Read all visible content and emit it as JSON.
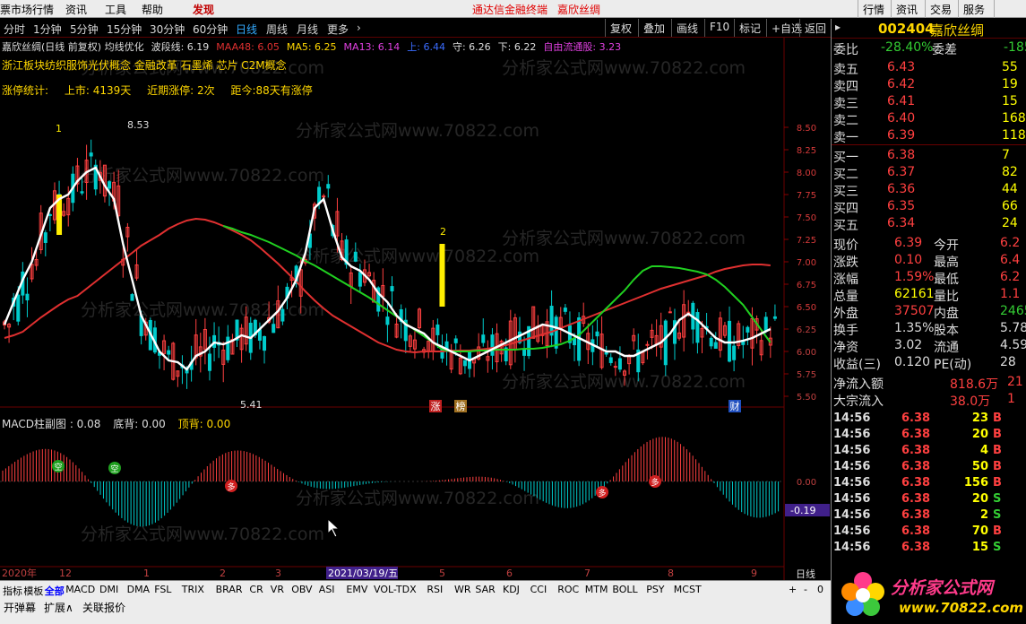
{
  "menu": {
    "items": [
      "票市场行情",
      "资讯",
      "工具",
      "帮助"
    ],
    "discover": "发现",
    "brand": "通达信金融终端",
    "stock_title": "嘉欣丝绸",
    "right": [
      "行情",
      "资讯",
      "交易",
      "服务"
    ]
  },
  "periods": [
    "分时",
    "1分钟",
    "5分钟",
    "15分钟",
    "30分钟",
    "60分钟",
    "日线",
    "周线",
    "月线",
    "更多"
  ],
  "active_period": "日线",
  "toolbar": [
    "复权",
    "叠加",
    "画线",
    "F10",
    "标记",
    "+自选",
    "返回"
  ],
  "info": {
    "line1": [
      {
        "t": "嘉欣丝绸(日线 前复权) 均线优化",
        "c": "#ddd"
      },
      {
        "t": "波段线: 6.19",
        "c": "#ddd"
      },
      {
        "t": "MAA48: 6.05",
        "c": "#e03030"
      },
      {
        "t": "MA5: 6.25",
        "c": "#ffd700"
      },
      {
        "t": "MA13: 6.14",
        "c": "#e040e0"
      },
      {
        "t": "上: 6.44",
        "c": "#3a6cff"
      },
      {
        "t": "守: 6.26",
        "c": "#ddd"
      },
      {
        "t": "下: 6.22",
        "c": "#ddd"
      },
      {
        "t": "自由流通股: 3.23",
        "c": "#e040e0"
      }
    ],
    "concepts": "浙江板块纺织服饰光伏概念 金融改革 石墨烯 芯片 C2M概念",
    "limit": {
      "label": "涨停统计:",
      "listed": "上市: 4139天",
      "recent": "近期涨停: 2次",
      "since": "距今:88天有涨停"
    }
  },
  "chart_data": {
    "type": "line",
    "title": "嘉欣丝绸(日线 前复权)",
    "ylim": [
      5.5,
      8.8
    ],
    "y_ticks": [
      "8.50",
      "8.25",
      "8.00",
      "7.75",
      "7.50",
      "7.25",
      "7.00",
      "6.75",
      "6.50",
      "6.25",
      "6.00",
      "5.75",
      "5.50"
    ],
    "series": [
      {
        "name": "MAA48",
        "color": "#e03030",
        "values": [
          6.15,
          6.18,
          6.22,
          6.3,
          6.38,
          6.45,
          6.52,
          6.58,
          6.62,
          6.7,
          6.78,
          6.86,
          6.94,
          7.02,
          7.1,
          7.18,
          7.24,
          7.3,
          7.37,
          7.42,
          7.46,
          7.48,
          7.47,
          7.44,
          7.4,
          7.35,
          7.3,
          7.24,
          7.16,
          7.07,
          6.98,
          6.88,
          6.78,
          6.67,
          6.57,
          6.48,
          6.4,
          6.34,
          6.28,
          6.22,
          6.16,
          6.1,
          6.06,
          6.02,
          6.0,
          5.99,
          6.0,
          6.0,
          6.0,
          6.01,
          6.01,
          6.01,
          6.02,
          6.03,
          6.05,
          6.07,
          6.1,
          6.13,
          6.16,
          6.19,
          6.22,
          6.26,
          6.3,
          6.34,
          6.38,
          6.42,
          6.46,
          6.5,
          6.54,
          6.58,
          6.62,
          6.66,
          6.7,
          6.73,
          6.76,
          6.79,
          6.82,
          6.85,
          6.89,
          6.92,
          6.94,
          6.96,
          6.97,
          6.97,
          6.96
        ]
      },
      {
        "name": "MA48",
        "color": "#20d020",
        "values": [
          null,
          null,
          null,
          null,
          null,
          null,
          null,
          null,
          null,
          null,
          null,
          null,
          null,
          null,
          null,
          null,
          null,
          null,
          null,
          null,
          null,
          null,
          null,
          null,
          7.4,
          7.37,
          7.33,
          7.3,
          7.26,
          7.22,
          7.17,
          7.12,
          7.07,
          7.01,
          6.96,
          6.9,
          6.84,
          6.78,
          6.72,
          6.66,
          6.6,
          6.53,
          6.46,
          6.39,
          6.31,
          6.24,
          6.17,
          6.1,
          6.02,
          6.0,
          6.0,
          6.0,
          6.01,
          6.01,
          6.02,
          6.02,
          6.02,
          6.03,
          6.03,
          6.04,
          6.06,
          6.08,
          6.12,
          6.18,
          6.28,
          6.38,
          6.48,
          6.58,
          6.68,
          6.8,
          6.9,
          6.95,
          6.95,
          6.94,
          6.93,
          6.91,
          6.89,
          6.86,
          6.8,
          6.72,
          6.62,
          6.52,
          6.38,
          6.24,
          6.1
        ]
      },
      {
        "name": "MA5",
        "color": "#ffffff",
        "values": [
          6.3,
          6.55,
          6.8,
          7.0,
          7.3,
          7.6,
          7.7,
          7.75,
          7.9,
          8.0,
          8.05,
          7.85,
          7.7,
          7.2,
          6.8,
          6.4,
          6.2,
          6.0,
          5.9,
          5.88,
          5.8,
          5.95,
          6.0,
          6.1,
          6.08,
          6.12,
          6.18,
          6.15,
          6.25,
          6.35,
          6.45,
          6.6,
          6.8,
          7.1,
          7.6,
          7.7,
          7.35,
          7.05,
          6.95,
          6.9,
          6.8,
          6.65,
          6.55,
          6.4,
          6.3,
          6.25,
          6.2,
          6.1,
          6.05,
          6.0,
          5.95,
          5.9,
          5.95,
          6.0,
          6.05,
          6.1,
          6.15,
          6.2,
          6.25,
          6.3,
          6.28,
          6.25,
          6.2,
          6.15,
          6.1,
          6.05,
          6.0,
          6.0,
          5.95,
          5.95,
          6.0,
          6.05,
          6.1,
          6.2,
          6.35,
          6.42,
          6.35,
          6.25,
          6.15,
          6.1,
          6.1,
          6.12,
          6.15,
          6.2,
          6.25
        ]
      }
    ],
    "x_labels": [
      "2020年",
      "12",
      "1",
      "2",
      "3",
      "2021/03/19/五",
      "5",
      "6",
      "7",
      "8",
      "9"
    ],
    "annotations": {
      "high": "8.53",
      "low": "5.41",
      "tag1": "1",
      "tag2": "2"
    },
    "badges": [
      "涨",
      "榜",
      "财"
    ],
    "macd": {
      "title": "MACD柱副图",
      "value": "0.08",
      "label2": "底背: 0.00",
      "label3": "顶背: 0.00",
      "ticks": [
        "0.00"
      ],
      "cursor": "-0.19",
      "signals": [
        "空",
        "空",
        "多",
        "多",
        "多"
      ]
    }
  },
  "bottom_tabs": [
    "指标",
    "模板",
    "全部",
    "MACD",
    "DMI",
    "DMA",
    "FSL",
    "TRIX",
    "BRAR",
    "CR",
    "VR",
    "OBV",
    "ASI",
    "EMV",
    "VOL-TDX",
    "RSI",
    "WR",
    "SAR",
    "KDJ",
    "CCI",
    "ROC",
    "MTM",
    "BOLL",
    "PSY",
    "MCST"
  ],
  "bottom_right": [
    "日线",
    "+",
    "-",
    "0"
  ],
  "bottom2": [
    "开弹幕",
    "扩展∧",
    "关联报价"
  ],
  "quote": {
    "code": "002404",
    "name": "嘉欣丝绸",
    "wb_label": "委比",
    "wb": "-28.40%",
    "wc_label": "委差",
    "wc": "-185",
    "asks": [
      {
        "l": "卖五",
        "p": "6.43",
        "v": "55"
      },
      {
        "l": "卖四",
        "p": "6.42",
        "v": "19"
      },
      {
        "l": "卖三",
        "p": "6.41",
        "v": "15"
      },
      {
        "l": "卖二",
        "p": "6.40",
        "v": "168"
      },
      {
        "l": "卖一",
        "p": "6.39",
        "v": "118"
      }
    ],
    "bids": [
      {
        "l": "买一",
        "p": "6.38",
        "v": "7"
      },
      {
        "l": "买二",
        "p": "6.37",
        "v": "82"
      },
      {
        "l": "买三",
        "p": "6.36",
        "v": "44"
      },
      {
        "l": "买四",
        "p": "6.35",
        "v": "66"
      },
      {
        "l": "买五",
        "p": "6.34",
        "v": "24"
      }
    ],
    "stats": [
      {
        "l": "现价",
        "v": "6.39",
        "c": "red",
        "l2": "今开",
        "v2": "6.2",
        "c2": "red"
      },
      {
        "l": "涨跌",
        "v": "0.10",
        "c": "red",
        "l2": "最高",
        "v2": "6.4",
        "c2": "red"
      },
      {
        "l": "涨幅",
        "v": "1.59%",
        "c": "red",
        "l2": "最低",
        "v2": "6.2",
        "c2": "red"
      },
      {
        "l": "总量",
        "v": "62161",
        "c": "yel",
        "l2": "量比",
        "v2": "1.1",
        "c2": "red"
      },
      {
        "l": "外盘",
        "v": "37507",
        "c": "red",
        "l2": "内盘",
        "v2": "2465",
        "c2": "grn"
      },
      {
        "l": "换手",
        "v": "1.35%",
        "c": "wht",
        "l2": "股本",
        "v2": "5.78",
        "c2": "wht"
      },
      {
        "l": "净资",
        "v": "3.02",
        "c": "wht",
        "l2": "流通",
        "v2": "4.59",
        "c2": "wht"
      },
      {
        "l": "收益(三)",
        "v": "0.120",
        "c": "wht",
        "l2": "PE(动)",
        "v2": "28",
        "c2": "wht"
      }
    ],
    "flow": [
      {
        "l": "净流入额",
        "v": "818.6万",
        "v2": "21"
      },
      {
        "l": "大宗流入",
        "v": "38.0万",
        "v2": "1"
      }
    ],
    "ticks": [
      {
        "t": "14:56",
        "p": "6.38",
        "v": "23",
        "s": "B"
      },
      {
        "t": "14:56",
        "p": "6.38",
        "v": "20",
        "s": "B"
      },
      {
        "t": "14:56",
        "p": "6.38",
        "v": "4",
        "s": "B"
      },
      {
        "t": "14:56",
        "p": "6.38",
        "v": "50",
        "s": "B"
      },
      {
        "t": "14:56",
        "p": "6.38",
        "v": "156",
        "s": "B"
      },
      {
        "t": "14:56",
        "p": "6.38",
        "v": "20",
        "s": "S"
      },
      {
        "t": "14:56",
        "p": "6.38",
        "v": "2",
        "s": "S"
      },
      {
        "t": "14:56",
        "p": "6.38",
        "v": "70",
        "s": "B"
      },
      {
        "t": "14:56",
        "p": "6.38",
        "v": "15",
        "s": "S"
      }
    ],
    "logo_text": "分析家公式网",
    "logo_url": "www.70822.com"
  },
  "watermark": "分析家公式网www.70822.com"
}
